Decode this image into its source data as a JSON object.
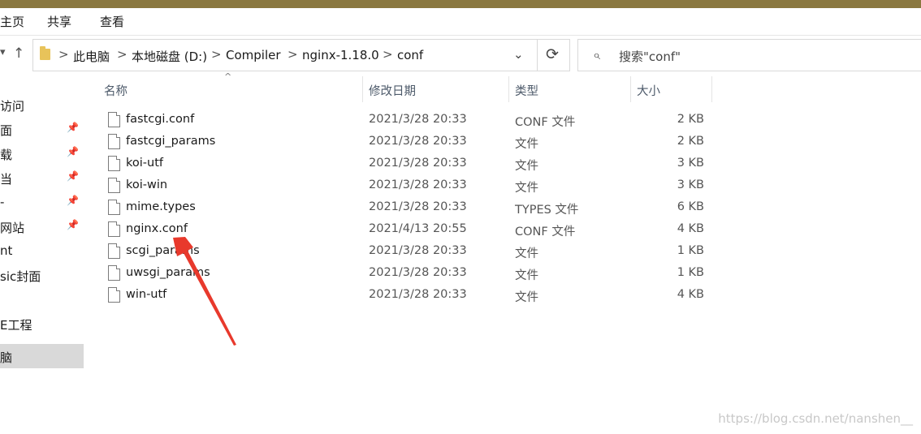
{
  "ribbon": {
    "tabs": [
      "主页",
      "共享",
      "查看"
    ]
  },
  "nav": {
    "up_arrow": "↑",
    "dropdown_arrow": "▾"
  },
  "address": {
    "crumbs": [
      "此电脑",
      "本地磁盘 (D:)",
      "Compiler",
      "nginx-1.18.0",
      "conf"
    ],
    "separator": ">",
    "dropdown": "⌄",
    "refresh": "⟳"
  },
  "search": {
    "placeholder": "搜索\"conf\"",
    "icon": "⌕"
  },
  "sidebar": {
    "items": [
      {
        "label": "访问",
        "pinned": false,
        "selected": false
      },
      {
        "label": "面",
        "pinned": true,
        "selected": false
      },
      {
        "label": "载",
        "pinned": true,
        "selected": false
      },
      {
        "label": "当",
        "pinned": true,
        "selected": false
      },
      {
        "label": "-",
        "pinned": true,
        "selected": false
      },
      {
        "label": "网站",
        "pinned": true,
        "selected": false
      },
      {
        "label": "nt",
        "pinned": false,
        "selected": false
      },
      {
        "label": "sic封面",
        "pinned": false,
        "selected": false
      },
      {
        "label": "E工程",
        "pinned": false,
        "selected": false
      },
      {
        "label": "脑",
        "pinned": false,
        "selected": true
      }
    ],
    "pin_icon": "📌"
  },
  "columns": {
    "name": "名称",
    "date": "修改日期",
    "type": "类型",
    "size": "大小",
    "sort_indicator": "^"
  },
  "files": [
    {
      "name": "fastcgi.conf",
      "date": "2021/3/28 20:33",
      "type": "CONF 文件",
      "size": "2 KB"
    },
    {
      "name": "fastcgi_params",
      "date": "2021/3/28 20:33",
      "type": "文件",
      "size": "2 KB"
    },
    {
      "name": "koi-utf",
      "date": "2021/3/28 20:33",
      "type": "文件",
      "size": "3 KB"
    },
    {
      "name": "koi-win",
      "date": "2021/3/28 20:33",
      "type": "文件",
      "size": "3 KB"
    },
    {
      "name": "mime.types",
      "date": "2021/3/28 20:33",
      "type": "TYPES 文件",
      "size": "6 KB"
    },
    {
      "name": "nginx.conf",
      "date": "2021/4/13 20:55",
      "type": "CONF 文件",
      "size": "4 KB"
    },
    {
      "name": "scgi_params",
      "date": "2021/3/28 20:33",
      "type": "文件",
      "size": "1 KB"
    },
    {
      "name": "uwsgi_params",
      "date": "2021/3/28 20:33",
      "type": "文件",
      "size": "1 KB"
    },
    {
      "name": "win-utf",
      "date": "2021/3/28 20:33",
      "type": "文件",
      "size": "4 KB"
    }
  ],
  "annotation": {
    "color": "#e8392c"
  },
  "watermark": "https://blog.csdn.net/nanshen__"
}
